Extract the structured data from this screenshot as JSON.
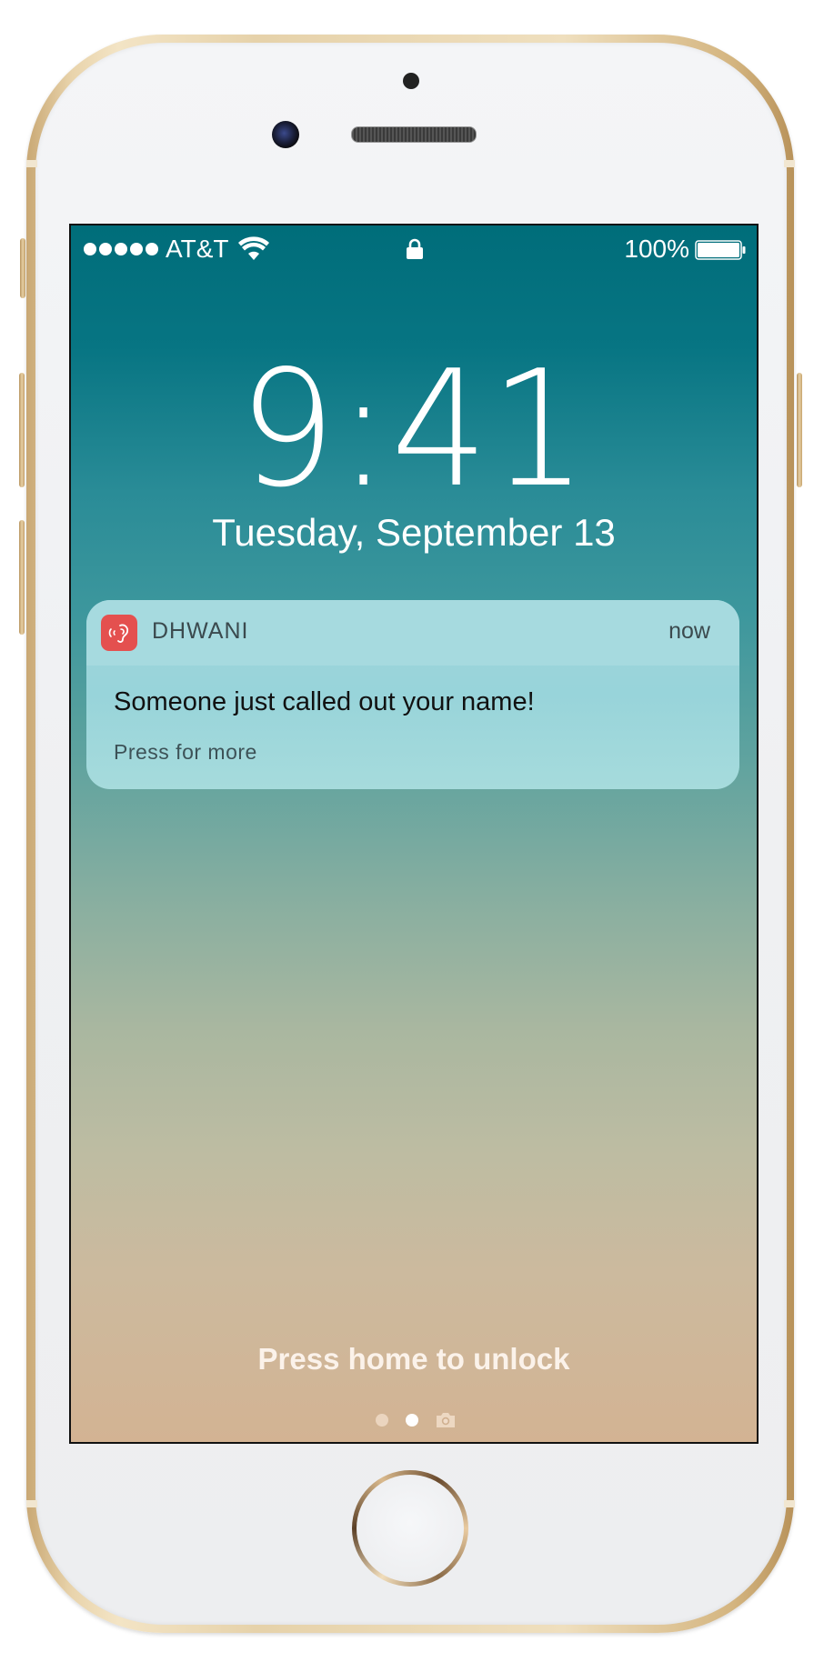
{
  "status_bar": {
    "carrier": "AT&T",
    "battery_percent": "100%",
    "signal_bars": 5,
    "battery_level": 1.0
  },
  "lock_screen": {
    "time": "9:41",
    "date": "Tuesday, September 13",
    "unlock_hint": "Press home to unlock",
    "page_count": 2,
    "current_page": 1
  },
  "notification": {
    "app_name": "DHWANI",
    "time": "now",
    "message": "Someone just called out your name!",
    "hint": "Press for more",
    "app_icon": "ear-icon",
    "app_icon_color": "#e4504f"
  },
  "colors": {
    "wallpaper_top": "#006d7a",
    "wallpaper_bottom": "#d3b393",
    "frame_gold": "#e9d4ac"
  }
}
